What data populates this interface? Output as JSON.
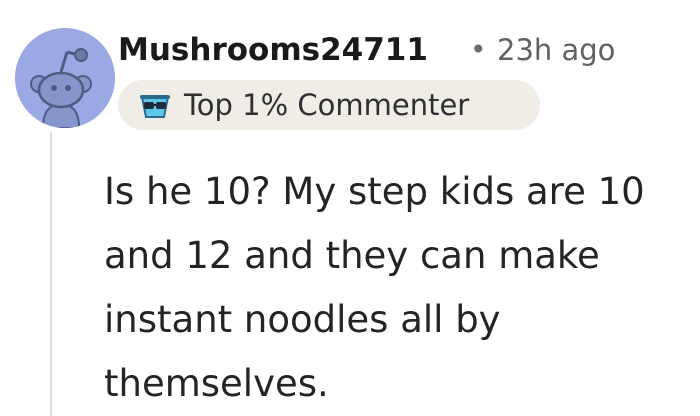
{
  "comment": {
    "author": "Mushrooms24711",
    "separator": "•",
    "timestamp": "23h ago",
    "badge": {
      "label": "Top 1% Commenter",
      "icon": "sunglasses-badge-icon"
    },
    "avatar_icon": "snoo-avatar-icon",
    "body": "Is he 10? My step kids are 10 and 12 and they can make instant noodles all by themselves."
  },
  "colors": {
    "avatar_bg": "#9aa9e4",
    "badge_bg": "#f0ece6",
    "thread_line": "#e3d9cf",
    "text": "#222426",
    "meta_text": "#5f6263"
  }
}
